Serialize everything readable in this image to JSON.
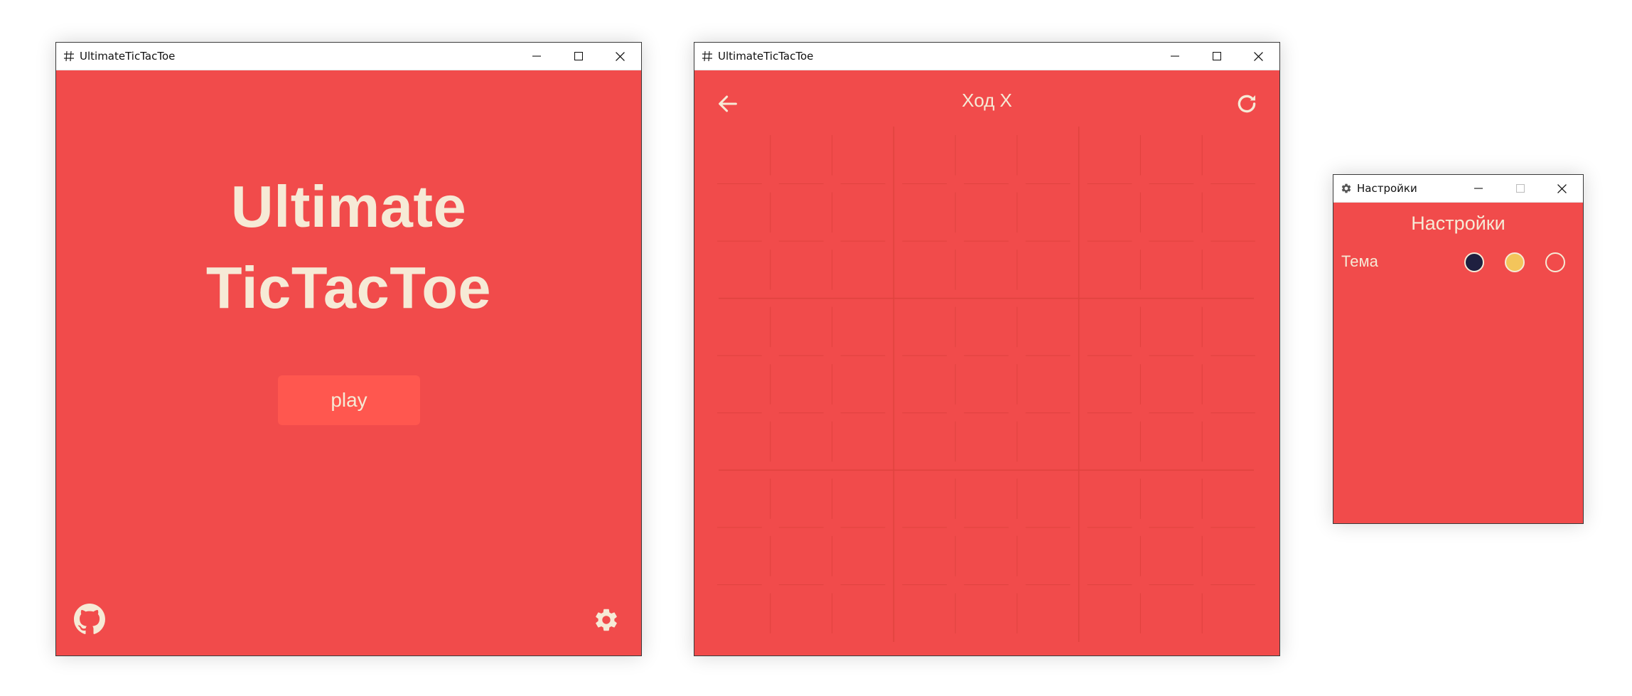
{
  "colors": {
    "background": "#f14b4b",
    "foreground": "#f6ead6",
    "button": "#ff574f",
    "grid_line": "#e0433f"
  },
  "main_window": {
    "title": "UltimateTicTacToe",
    "app_title_line1": "Ultimate",
    "app_title_line2": "TicTacToe",
    "play_label": "play",
    "icons": {
      "app": "hash-icon",
      "github": "github-icon",
      "settings": "gear-icon"
    }
  },
  "game_window": {
    "title": "UltimateTicTacToe",
    "turn_label": "Ход X",
    "board": {
      "big_grid": 3,
      "small_grid": 3,
      "cells": []
    },
    "icons": {
      "app": "hash-icon",
      "back": "arrow-left-icon",
      "restart": "refresh-icon"
    }
  },
  "settings_window": {
    "title": "Настройки",
    "heading": "Настройки",
    "theme_label": "Тема",
    "themes": [
      {
        "name": "dark",
        "color": "#1f2040"
      },
      {
        "name": "yellow",
        "color": "#f3c55b"
      },
      {
        "name": "red",
        "color": "#f14b4b"
      }
    ],
    "icons": {
      "app": "gear-icon"
    }
  }
}
